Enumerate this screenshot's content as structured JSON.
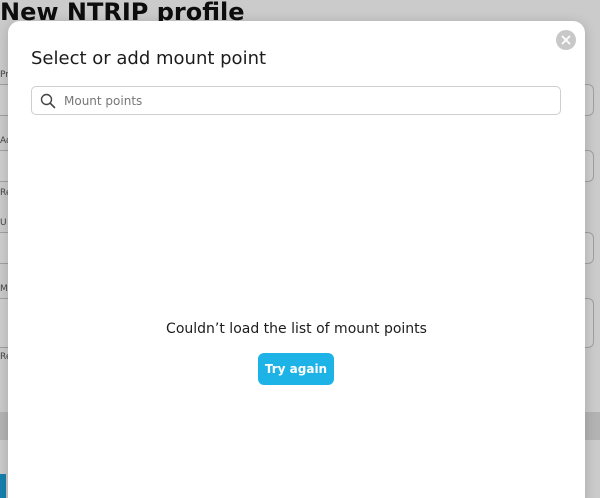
{
  "background": {
    "title": "New NTRIP profile",
    "field_labels": [
      "Pr",
      "Ad",
      "Re",
      "U",
      "M",
      "Re"
    ]
  },
  "modal": {
    "title": "Select or add mount point",
    "search": {
      "placeholder": "Mount points",
      "value": ""
    },
    "error_message": "Couldn’t load the list of mount points",
    "retry_label": "Try again",
    "close_icon": "close-icon",
    "search_icon": "search-icon"
  },
  "colors": {
    "accent": "#1db3e7",
    "close_button": "#c8c8c8"
  }
}
